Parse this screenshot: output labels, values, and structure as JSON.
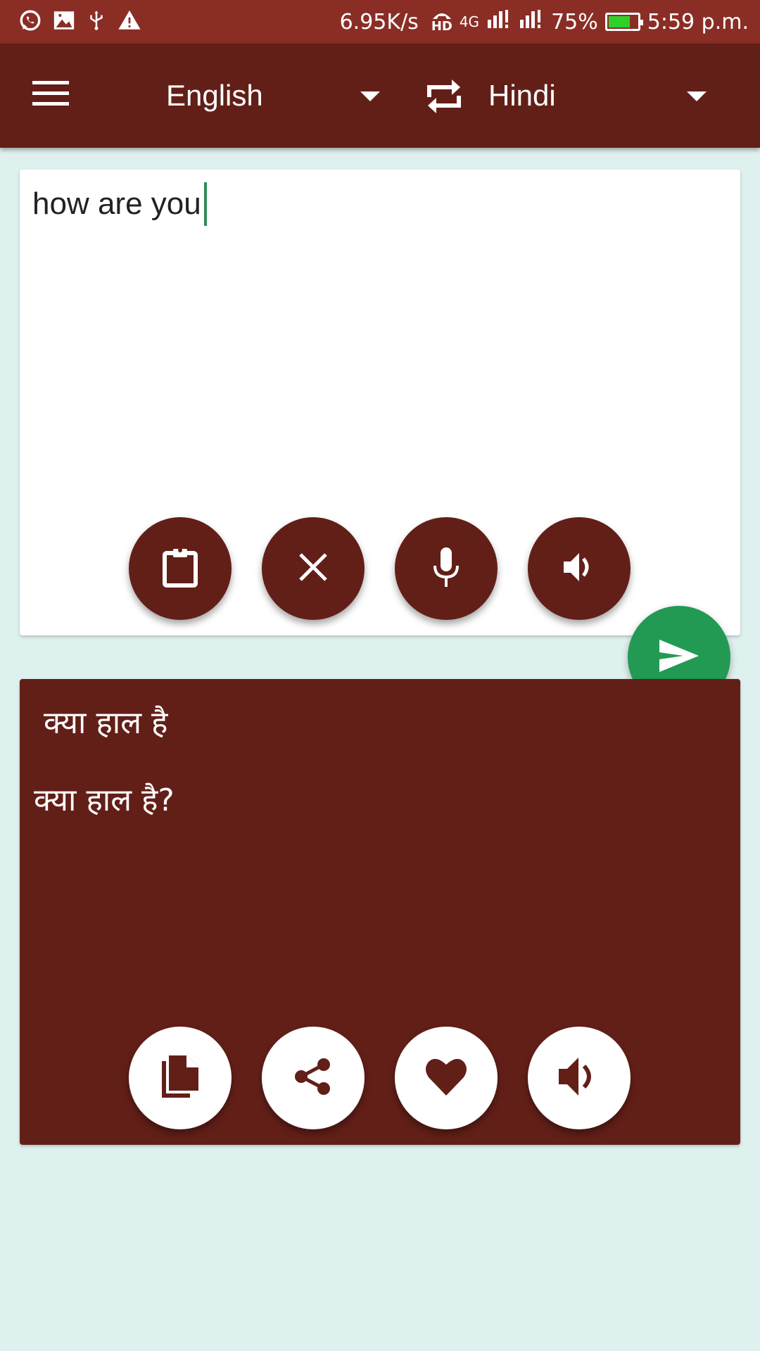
{
  "status_bar": {
    "left_icons": [
      "whatsapp-icon",
      "image-icon",
      "usb-icon",
      "warning-icon"
    ],
    "network_speed": "6.95K/s",
    "hd_label": "HD",
    "network_type": "4G",
    "sim1": "1",
    "sim2": "2",
    "battery_percent": "75%",
    "battery_level": 0.75,
    "battery_color": "#2ed12a",
    "time": "5:59 p.m."
  },
  "app_bar": {
    "menu_icon": "hamburger-menu-icon",
    "source_language": "English",
    "swap_icon": "swap-languages-icon",
    "target_language": "Hindi",
    "background_color": "#621f18"
  },
  "input_card": {
    "text": "how are you",
    "buttons": [
      {
        "name": "paste",
        "icon": "clipboard-icon"
      },
      {
        "name": "clear",
        "icon": "close-icon"
      },
      {
        "name": "voice-input",
        "icon": "microphone-icon"
      },
      {
        "name": "speak-input",
        "icon": "speaker-icon"
      }
    ]
  },
  "translate_button": {
    "icon": "send-icon",
    "color": "#229a53"
  },
  "output_card": {
    "transliteration": "क्या हाल है",
    "translation": "क्या हाल है?",
    "buttons": [
      {
        "name": "copy",
        "icon": "copy-icon"
      },
      {
        "name": "share",
        "icon": "share-icon"
      },
      {
        "name": "favorite",
        "icon": "heart-icon"
      },
      {
        "name": "speak-output",
        "icon": "speaker-icon"
      }
    ]
  }
}
